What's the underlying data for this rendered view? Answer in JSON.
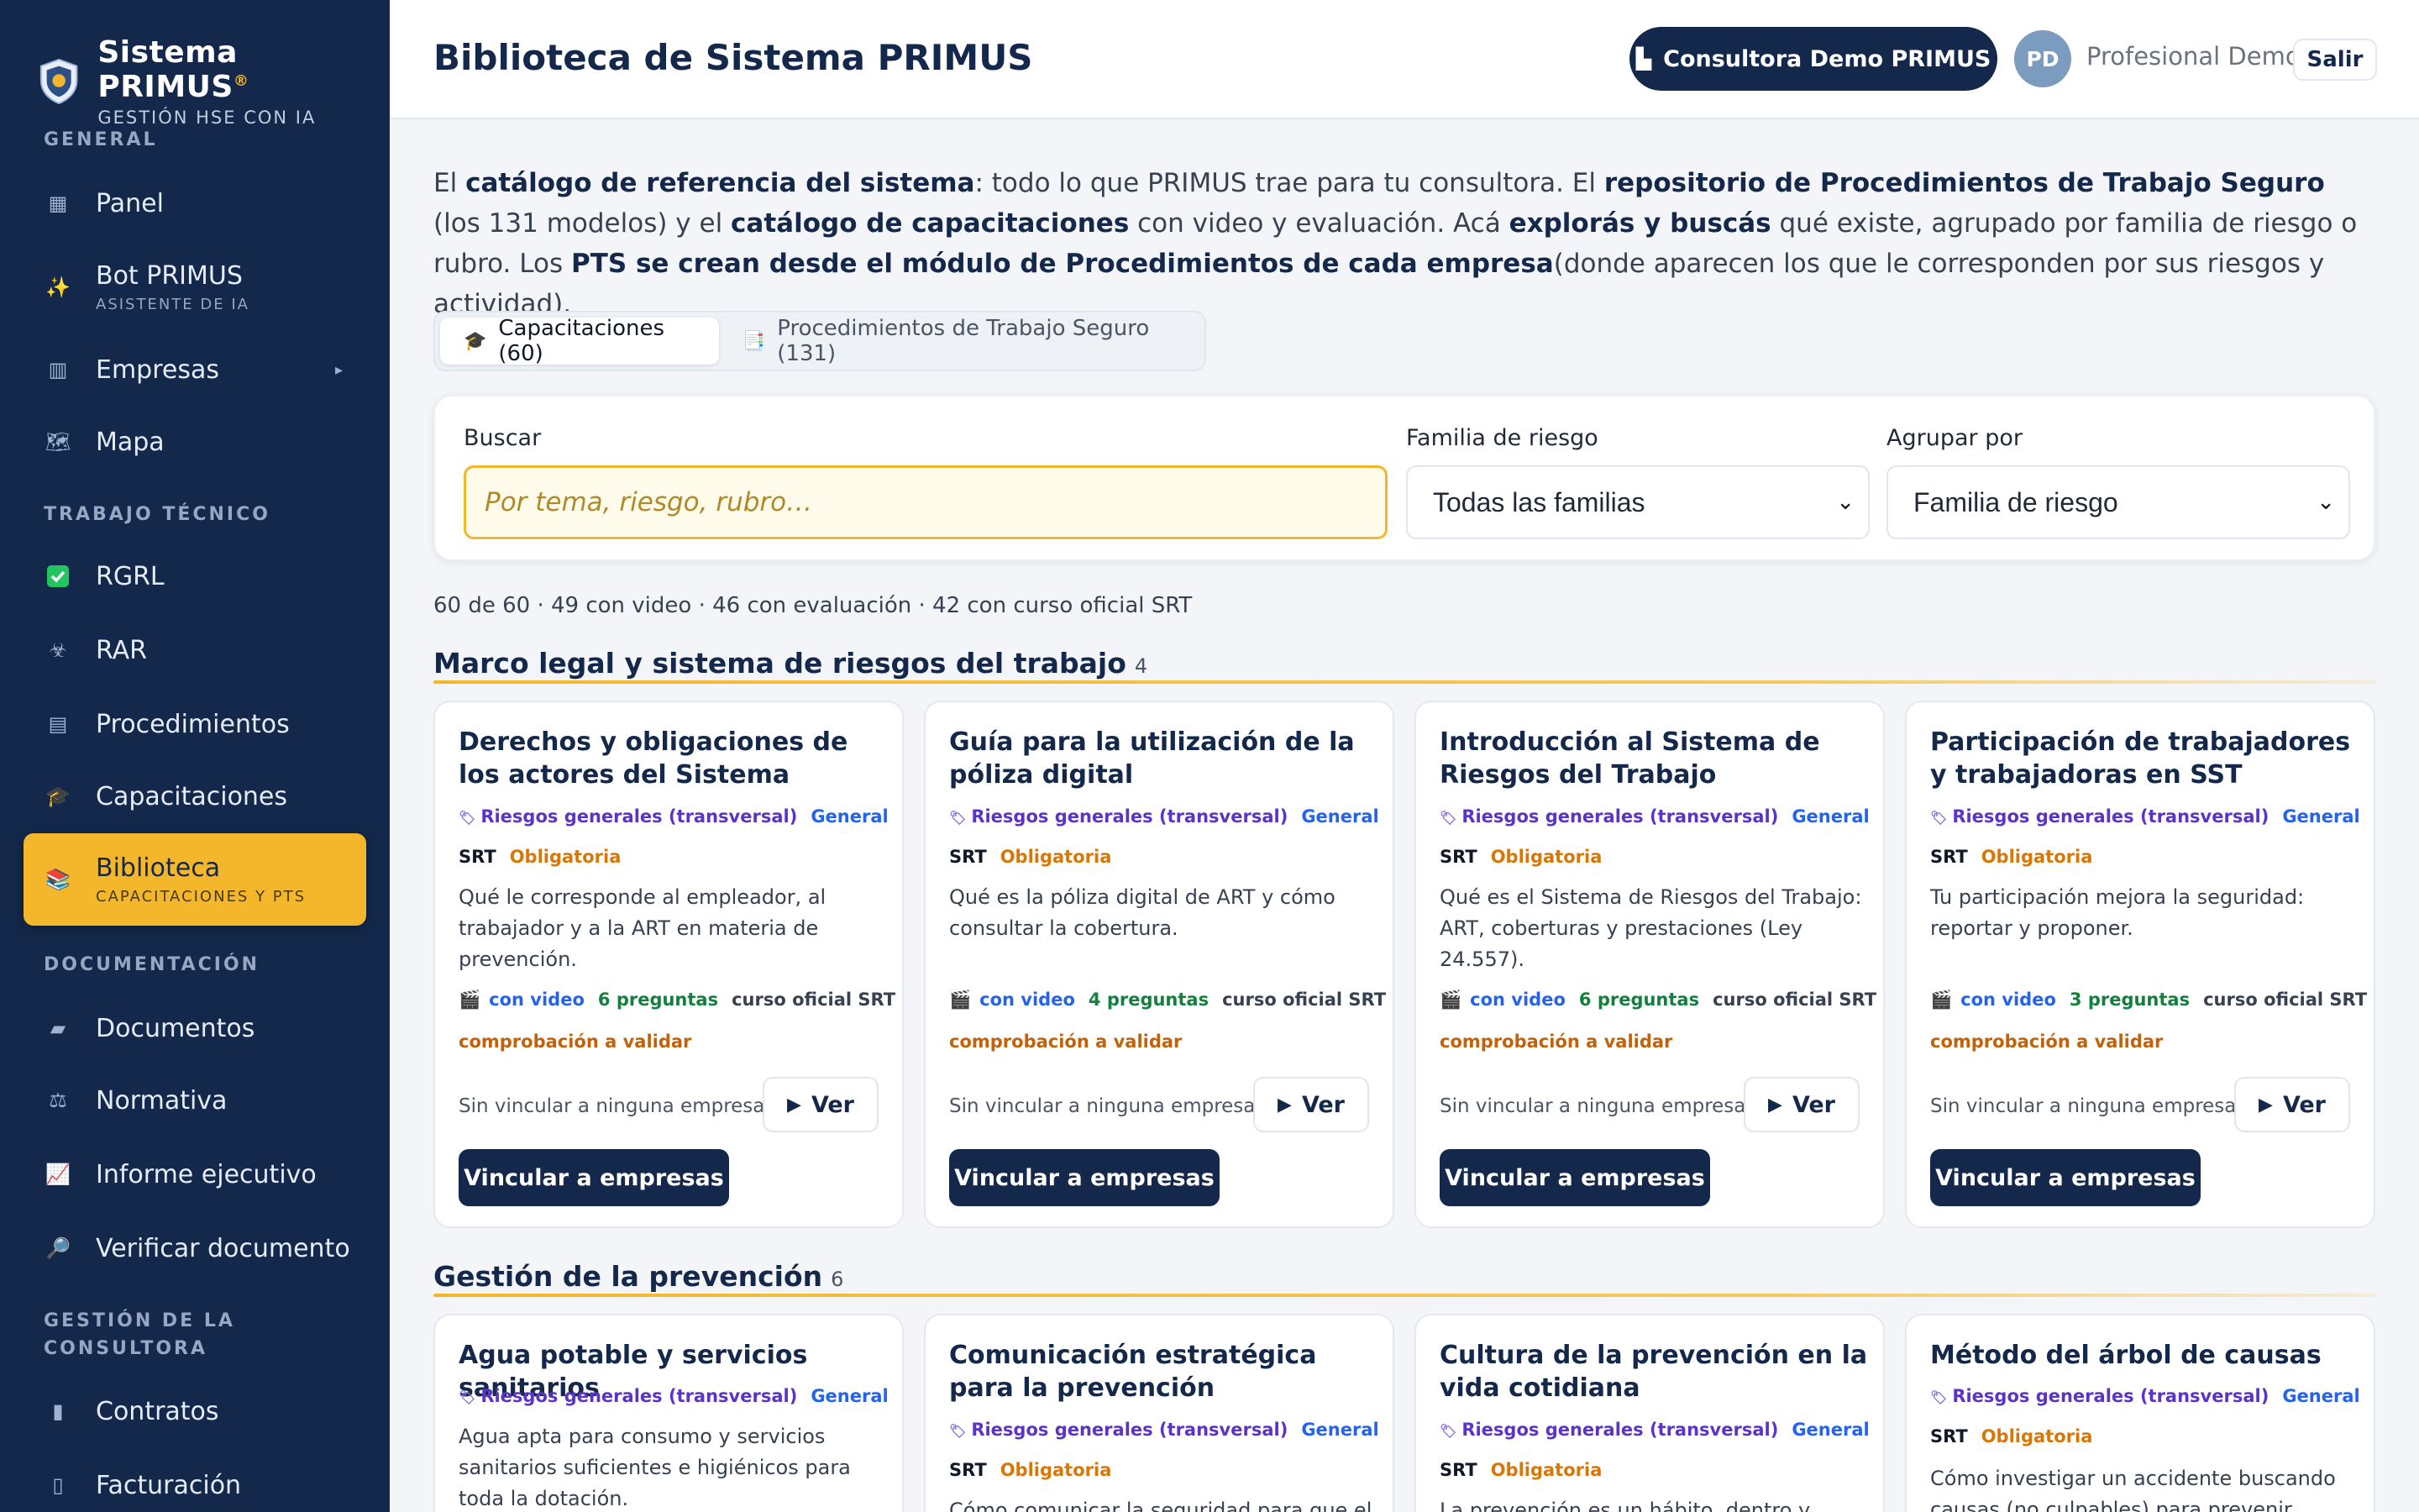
{
  "brand": {
    "name": "Sistema PRIMUS",
    "mark": "®",
    "tagline": "GESTIÓN HSE CON IA"
  },
  "sidebar": {
    "sections": [
      {
        "label": "GENERAL"
      },
      {
        "label": "TRABAJO TÉCNICO"
      },
      {
        "label": "DOCUMENTACIÓN"
      },
      {
        "label": "GESTIÓN DE LA CONSULTORA"
      }
    ],
    "items": [
      {
        "label": "Panel",
        "icon": "grid-icon"
      },
      {
        "label": "Bot PRIMUS",
        "sub": "ASISTENTE DE IA",
        "icon": "sparkles-icon"
      },
      {
        "label": "Empresas",
        "icon": "building-icon"
      },
      {
        "label": "Mapa",
        "icon": "map-icon"
      },
      {
        "label": "RGRL",
        "icon": "check-box-icon"
      },
      {
        "label": "RAR",
        "icon": "biohazard-icon"
      },
      {
        "label": "Procedimientos",
        "icon": "document-icon"
      },
      {
        "label": "Capacitaciones",
        "icon": "graduation-cap-icon"
      },
      {
        "label": "Biblioteca",
        "sub": "CAPACITACIONES Y PTS",
        "icon": "books-icon"
      },
      {
        "label": "Documentos",
        "icon": "folder-icon"
      },
      {
        "label": "Normativa",
        "icon": "scales-icon"
      },
      {
        "label": "Informe ejecutivo",
        "icon": "chart-icon"
      },
      {
        "label": "Verificar documento",
        "icon": "magnifier-icon"
      },
      {
        "label": "Contratos",
        "icon": "page-icon"
      },
      {
        "label": "Facturación",
        "icon": "receipt-icon"
      }
    ]
  },
  "header": {
    "title": "Biblioteca de Sistema PRIMUS",
    "consultora": "Consultora Demo PRIMUS",
    "avatar": "PD",
    "user": "Profesional Demo",
    "logout": "Salir"
  },
  "intro": {
    "p1": "El ",
    "b1": "catálogo de referencia del sistema",
    "p2": ": todo lo que PRIMUS trae para tu consultora. El ",
    "b2": "repositorio de Procedimientos de Trabajo Seguro",
    "p3": " (los 131 modelos) y el ",
    "b3": "catálogo de capacitaciones",
    "p4": " con video y evaluación. Acá ",
    "b4": "explorás y buscás",
    "p5": " qué existe, agrupado por familia de riesgo o rubro. Los ",
    "b5": "PTS se crean desde el módulo de Procedimientos de cada empresa",
    "p6": "(donde aparecen los que le corresponden por sus riesgos y actividad)."
  },
  "tabs": [
    {
      "label": "Capacitaciones (60)",
      "icon": "graduation-cap-icon"
    },
    {
      "label": "Procedimientos de Trabajo Seguro (131)",
      "icon": "document-icon"
    }
  ],
  "filters": {
    "search_label": "Buscar",
    "search_placeholder": "Por tema, riesgo, rubro…",
    "family_label": "Familia de riesgo",
    "family_value": "Todas las familias",
    "group_label": "Agrupar por",
    "group_value": "Familia de riesgo"
  },
  "counts": "60 de 60 · 49 con video · 46 con evaluación · 42 con curso oficial SRT",
  "groups": [
    {
      "title": "Marco legal y sistema de riesgos del trabajo",
      "count": "4",
      "cards": [
        {
          "title": "Derechos y obligaciones de los actores del Sistema",
          "risk": "Riesgos generales (transversal)",
          "scope": "General",
          "org": "SRT",
          "req": "Obligatoria",
          "desc": "Qué le corresponde al empleador, al trabajador y a la ART en materia de prevención.",
          "video": "con video",
          "questions": "6 preguntas",
          "course": "curso oficial SRT",
          "validation": "comprobación a validar",
          "unlinked": "Sin vincular a ninguna empresa",
          "view": "Ver",
          "link": "Vincular a empresas"
        },
        {
          "title": "Guía para la utilización de la póliza digital",
          "risk": "Riesgos generales (transversal)",
          "scope": "General",
          "org": "SRT",
          "req": "Obligatoria",
          "desc": "Qué es la póliza digital de ART y cómo consultar la cobertura.",
          "video": "con video",
          "questions": "4 preguntas",
          "course": "curso oficial SRT",
          "validation": "comprobación a validar",
          "unlinked": "Sin vincular a ninguna empresa",
          "view": "Ver",
          "link": "Vincular a empresas"
        },
        {
          "title": "Introducción al Sistema de Riesgos del Trabajo",
          "risk": "Riesgos generales (transversal)",
          "scope": "General",
          "org": "SRT",
          "req": "Obligatoria",
          "desc": "Qué es el Sistema de Riesgos del Trabajo: ART, coberturas y prestaciones (Ley 24.557).",
          "video": "con video",
          "questions": "6 preguntas",
          "course": "curso oficial SRT",
          "validation": "comprobación a validar",
          "unlinked": "Sin vincular a ninguna empresa",
          "view": "Ver",
          "link": "Vincular a empresas"
        },
        {
          "title": "Participación de trabajadores y trabajadoras en SST",
          "risk": "Riesgos generales (transversal)",
          "scope": "General",
          "org": "SRT",
          "req": "Obligatoria",
          "desc": "Tu participación mejora la seguridad: reportar y proponer.",
          "video": "con video",
          "questions": "3 preguntas",
          "course": "curso oficial SRT",
          "validation": "comprobación a validar",
          "unlinked": "Sin vincular a ninguna empresa",
          "view": "Ver",
          "link": "Vincular a empresas"
        }
      ]
    },
    {
      "title": "Gestión de la prevención",
      "count": "6",
      "cards": [
        {
          "title": "Agua potable y servicios sanitarios",
          "risk": "Riesgos generales (transversal)",
          "scope": "General",
          "desc": "Agua apta para consumo y servicios sanitarios suficientes e higiénicos para toda la dotación."
        },
        {
          "title": "Comunicación estratégica para la prevención",
          "risk": "Riesgos generales (transversal)",
          "scope": "General",
          "org": "SRT",
          "req": "Obligatoria",
          "desc": "Cómo comunicar la seguridad para que el"
        },
        {
          "title": "Cultura de la prevención en la vida cotidiana",
          "risk": "Riesgos generales (transversal)",
          "scope": "General",
          "org": "SRT",
          "req": "Obligatoria",
          "desc": "La prevención es un hábito, dentro y fuera"
        },
        {
          "title": "Método del árbol de causas",
          "risk": "Riesgos generales (transversal)",
          "scope": "General",
          "org": "SRT",
          "req": "Obligatoria",
          "desc": "Cómo investigar un accidente buscando causas (no culpables) para prevenir"
        }
      ]
    }
  ]
}
